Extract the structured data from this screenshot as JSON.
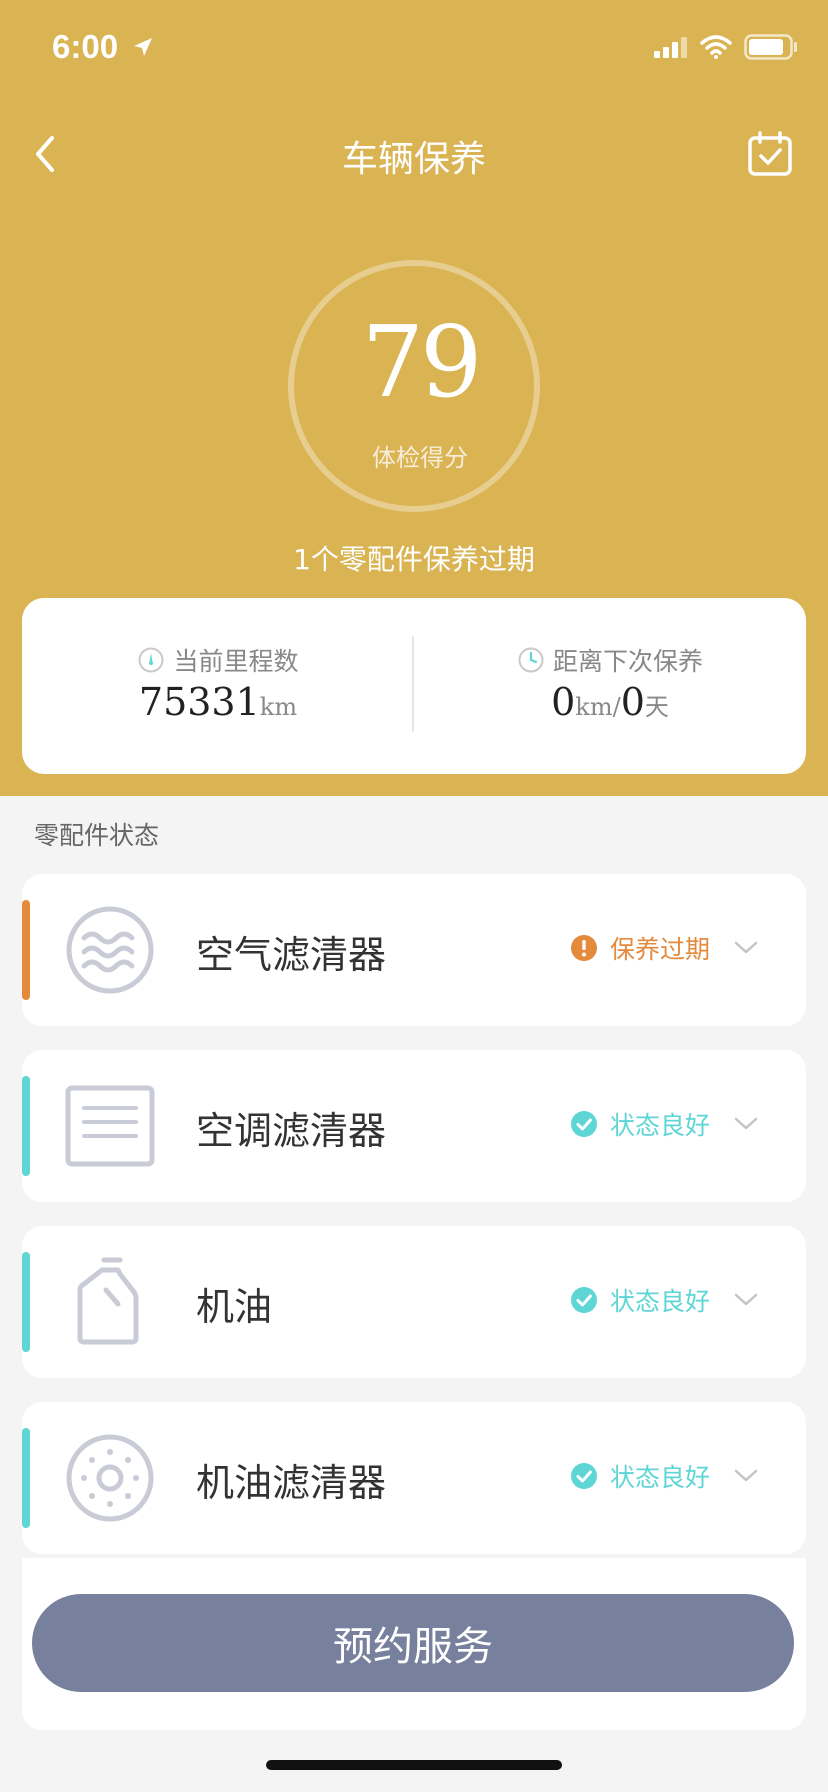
{
  "status_bar": {
    "time": "6:00"
  },
  "nav": {
    "title": "车辆保养"
  },
  "score": {
    "value": "79",
    "label": "体检得分",
    "ring_level": 0.79
  },
  "expire_note": "1个零配件保养过期",
  "stats": {
    "mileage": {
      "title": "当前里程数",
      "value": "75331",
      "unit": "km"
    },
    "next": {
      "title": "距离下次保养",
      "km_value": "0",
      "km_unit": "km",
      "sep": "/",
      "day_value": "0",
      "day_unit": "天"
    }
  },
  "section": {
    "label": "零配件状态"
  },
  "parts": [
    {
      "name": "空气滤清器",
      "status": "保养过期",
      "status_color": "#e38a3c",
      "icon": "air-filter-icon"
    },
    {
      "name": "空调滤清器",
      "status": "状态良好",
      "status_color": "#5fd6d6",
      "icon": "ac-filter-icon"
    },
    {
      "name": "机油",
      "status": "状态良好",
      "status_color": "#5fd6d6",
      "icon": "oil-bottle-icon"
    },
    {
      "name": "机油滤清器",
      "status": "状态良好",
      "status_color": "#5fd6d6",
      "icon": "oil-filter-icon"
    }
  ],
  "footer": {
    "button": "预约服务"
  },
  "colors": {
    "header": "#dab353",
    "button": "#77809c",
    "warning": "#e38a3c",
    "ok": "#5fd6d6"
  }
}
